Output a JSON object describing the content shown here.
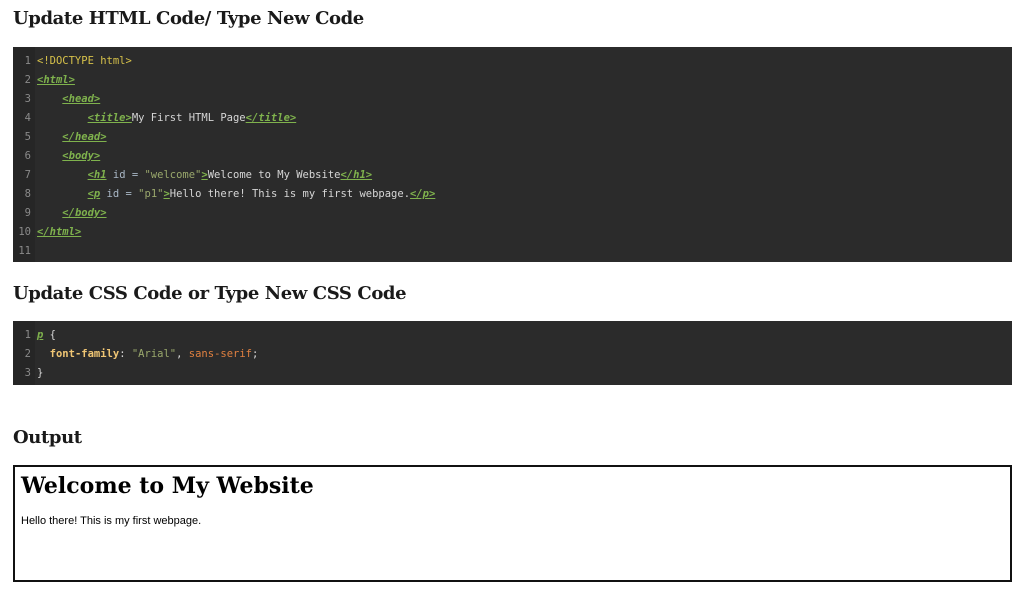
{
  "sections": {
    "html_heading": "Update HTML Code/ Type New Code",
    "css_heading": "Update CSS Code or Type New CSS Code",
    "output_heading": "Output"
  },
  "html_editor": {
    "line_numbers": [
      "1",
      "2",
      "3",
      "4",
      "5",
      "6",
      "7",
      "8",
      "9",
      "10",
      "11"
    ],
    "doctype": "<!DOCTYPE html>",
    "open_html": "<html>",
    "open_head": "<head>",
    "open_title": "<title>",
    "title_text": "My First HTML Page",
    "close_title": "</title>",
    "close_head": "</head>",
    "open_body": "<body>",
    "h1_open": "<h1",
    "h1_attr": " id = ",
    "h1_id": "\"welcome\"",
    "h1_gt": ">",
    "h1_text": "Welcome to My Website",
    "h1_close": "</h1>",
    "p_open": "<p",
    "p_attr": " id = ",
    "p_id": "\"p1\"",
    "p_gt": ">",
    "p_text": "Hello there! This is my first webpage.",
    "p_close": "</p>",
    "close_body": "</body>",
    "close_html": "</html>"
  },
  "css_editor": {
    "line_numbers": [
      "1",
      "2",
      "3"
    ],
    "selector": "p",
    "open_brace": " {",
    "property": "font-family",
    "colon": ": ",
    "value_string": "\"Arial\"",
    "comma": ", ",
    "value_keyword": "sans-serif",
    "semicolon": ";",
    "close_brace": "}"
  },
  "output": {
    "h1": "Welcome to My Website",
    "p": "Hello there! This is my first webpage."
  }
}
